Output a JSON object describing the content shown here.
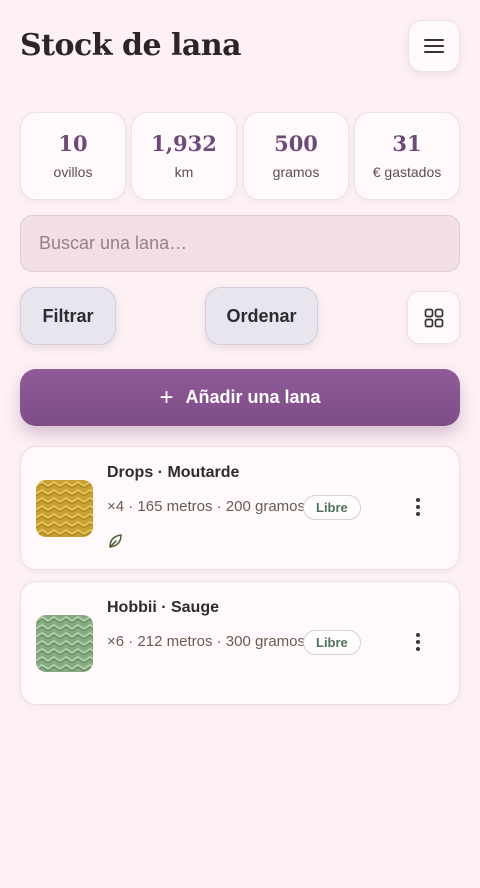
{
  "header": {
    "title": "Stock de lana",
    "menu_icon": "hamburger-menu-icon"
  },
  "stats": [
    {
      "value": "10",
      "label": "ovillos"
    },
    {
      "value": "1,932",
      "label": "km"
    },
    {
      "value": "500",
      "label": "gramos"
    },
    {
      "value": "31",
      "label": "€ gastados"
    }
  ],
  "search": {
    "placeholder": "Buscar una lana…",
    "value": ""
  },
  "toolbar": {
    "filter_label": "Filtrar",
    "sort_label": "Ordenar",
    "view_icon": "grid-view-icon"
  },
  "add_button": {
    "label": "Añadir una lana",
    "icon": "plus-icon"
  },
  "yarns": [
    {
      "name": "Drops · Moutarde",
      "meta": "×4 · 165 metros · 200 gramos",
      "badge": "Libre",
      "color": "#c9a030",
      "extra_icon": "leaf-icon"
    },
    {
      "name": "Hobbii · Sauge",
      "meta": "×6 · 212 metros · 300 gramos",
      "badge": "Libre",
      "color": "#86ab82"
    }
  ],
  "colors": {
    "background": "#fdf1f4",
    "accent": "#86558f",
    "stat_value": "#6e4a79",
    "badge_text": "#4f7358"
  }
}
